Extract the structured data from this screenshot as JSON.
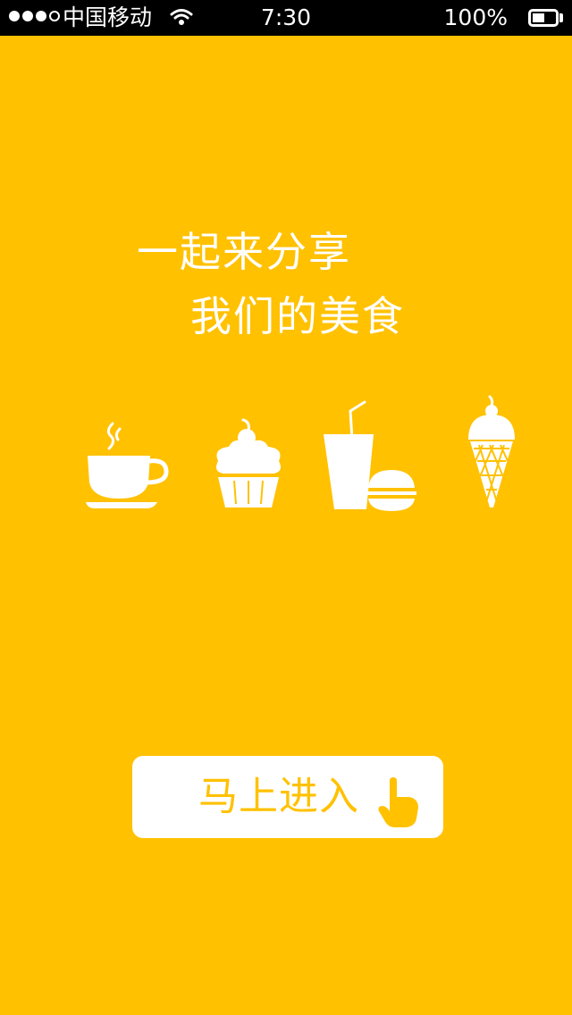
{
  "status_bar": {
    "carrier": "中国移动",
    "time": "7:30",
    "battery_percent": "100%",
    "signal_bars_filled": 3,
    "signal_bars_total": 4,
    "icons": [
      "wifi-icon",
      "battery-icon"
    ]
  },
  "headline": {
    "line1": "一起来分享",
    "line2": "我们的美食"
  },
  "food_icons": [
    "coffee-cup-icon",
    "cupcake-icon",
    "drink-burger-icon",
    "ice-cream-icon"
  ],
  "enter_button": {
    "label": "马上进入",
    "icon": "pointing-hand-icon"
  },
  "colors": {
    "background": "#FFC100",
    "status_bar": "#000000",
    "foreground": "#FFFFFF",
    "button_text": "#FFC100"
  }
}
